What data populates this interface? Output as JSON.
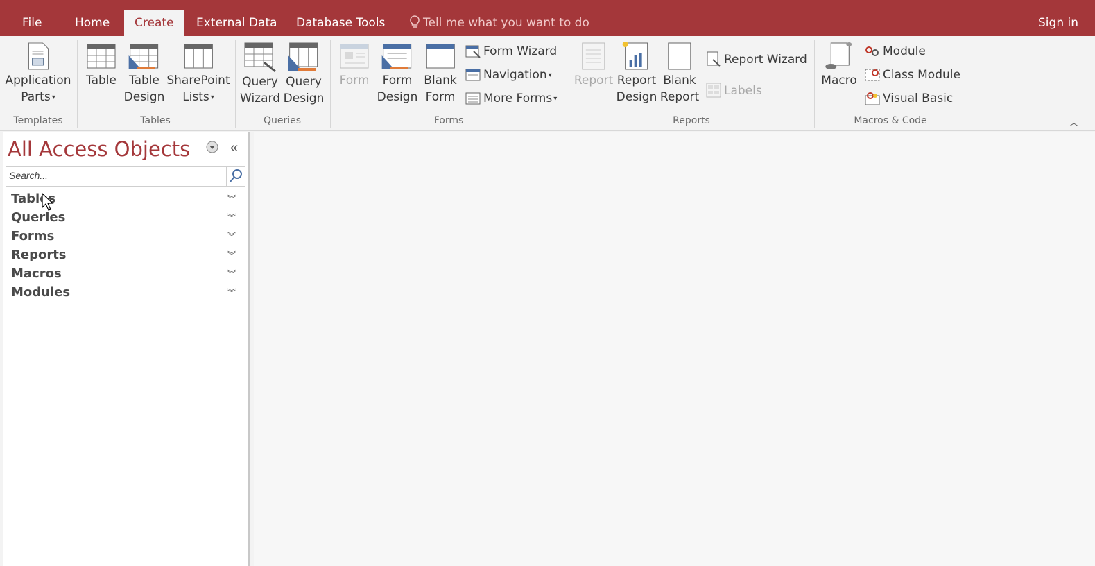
{
  "tabs": {
    "file": "File",
    "home": "Home",
    "create": "Create",
    "external": "External Data",
    "dbtools": "Database Tools",
    "tell": "Tell me what you want to do",
    "signin": "Sign in"
  },
  "ribbon": {
    "templates": {
      "app_parts_1": "Application",
      "app_parts_2": "Parts",
      "label": "Templates"
    },
    "tables": {
      "table": "Table",
      "table_design_1": "Table",
      "table_design_2": "Design",
      "sharepoint_1": "SharePoint",
      "sharepoint_2": "Lists",
      "label": "Tables"
    },
    "queries": {
      "wizard_1": "Query",
      "wizard_2": "Wizard",
      "design_1": "Query",
      "design_2": "Design",
      "label": "Queries"
    },
    "forms": {
      "form": "Form",
      "form_design_1": "Form",
      "form_design_2": "Design",
      "blank_1": "Blank",
      "blank_2": "Form",
      "wizard": "Form Wizard",
      "navigation": "Navigation",
      "more": "More Forms",
      "label": "Forms"
    },
    "reports": {
      "report": "Report",
      "design_1": "Report",
      "design_2": "Design",
      "blank_1": "Blank",
      "blank_2": "Report",
      "wizard": "Report Wizard",
      "labels": "Labels",
      "label": "Reports"
    },
    "macros": {
      "macro": "Macro",
      "module": "Module",
      "class_module": "Class Module",
      "visual_basic": "Visual Basic",
      "label": "Macros & Code"
    }
  },
  "nav": {
    "title": "All Access Objects",
    "search_placeholder": "Search...",
    "categories": [
      "Tables",
      "Queries",
      "Forms",
      "Reports",
      "Macros",
      "Modules"
    ]
  },
  "colors": {
    "accent": "#a4373a",
    "ribbon_bg": "#f3f3f3"
  }
}
